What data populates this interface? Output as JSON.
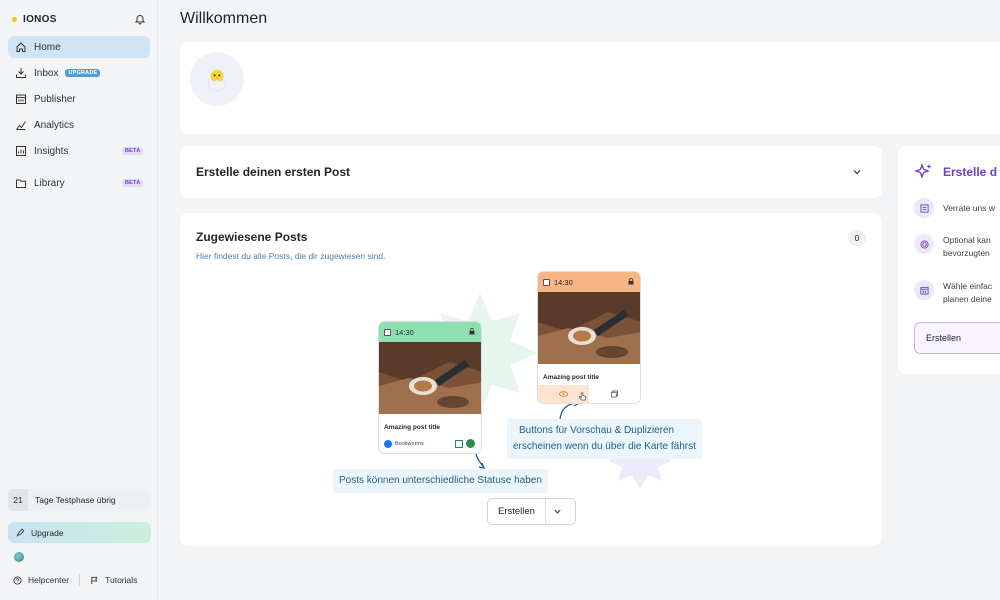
{
  "brand": {
    "name": "IONOS"
  },
  "sidebar": {
    "items": [
      {
        "label": "Home",
        "icon": "home-icon",
        "active": true
      },
      {
        "label": "Inbox",
        "icon": "inbox-icon",
        "badge": "UPGRADE"
      },
      {
        "label": "Publisher",
        "icon": "calendar-icon"
      },
      {
        "label": "Analytics",
        "icon": "analytics-icon"
      },
      {
        "label": "Insights",
        "icon": "insights-icon",
        "badge": "BETA"
      },
      {
        "label": "Library",
        "icon": "folder-icon",
        "badge": "BETA"
      }
    ],
    "trial": {
      "days": "21",
      "label": "Tage Testphase übrig"
    },
    "upgrade_label": "Upgrade",
    "helpcenter_label": "Helpcenter",
    "tutorials_label": "Tutorials"
  },
  "page": {
    "title": "Willkommen"
  },
  "first_post": {
    "title": "Erstelle deinen ersten Post"
  },
  "assigned": {
    "title": "Zugewiesene Posts",
    "subtitle": "Hier findest du alle Posts, die dir zugewiesen sind.",
    "count": "0",
    "card_green": {
      "time": "14:30",
      "title": "Amazing post title",
      "account": "Bookworms",
      "head_color": "#8fe0b0"
    },
    "card_orange": {
      "time": "14:30",
      "title": "Amazing post title",
      "head_color": "#f7b584"
    },
    "tip_buttons": "Buttons für Vorschau & Duplizieren",
    "tip_buttons_2": "erscheinen wenn du über die Karte fährst",
    "tip_status": "Posts können unterschiedliche Statuse haben",
    "create_label": "Erstellen"
  },
  "right_panel": {
    "title": "Erstelle d",
    "rows": [
      {
        "line1": "Verrate uns w",
        "line2": ""
      },
      {
        "line1": "Optional kan",
        "line2": "bevorzugten"
      },
      {
        "line1": "Wähle einfac",
        "line2": "planen deine"
      }
    ],
    "button_label": "Erstellen"
  },
  "colors": {
    "accent": "#6a40c6",
    "active_nav": "#cfe5f6",
    "tip": "#ecf5fb"
  }
}
